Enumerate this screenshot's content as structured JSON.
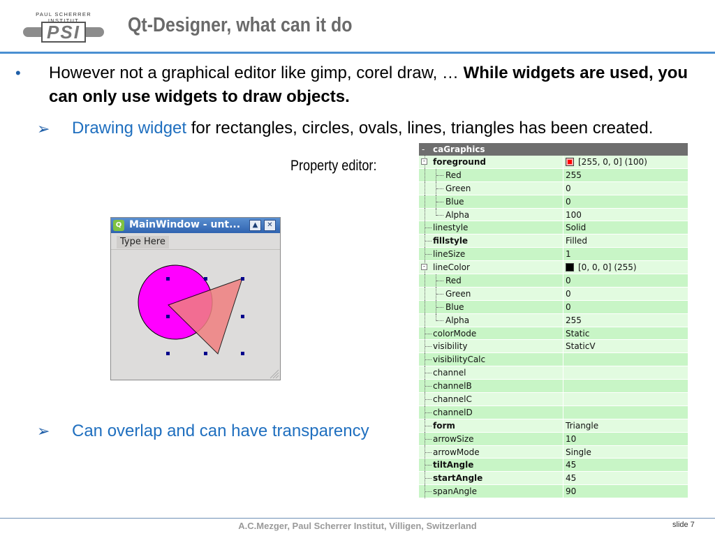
{
  "header": {
    "logo_caption": "PAUL SCHERRER INSTITUT",
    "logo_mark": "PSI",
    "title": "Qt-Designer, what can it do"
  },
  "bullets": {
    "b1_normal": "However not a graphical editor like gimp, corel draw, … ",
    "b1_bold": "While widgets are used, you can only use widgets to draw objects.",
    "sub1_highlight": "Drawing widget",
    "sub1_rest": " for rectangles, circles, ovals, lines, triangles has been created.",
    "property_label": "Property editor:",
    "sub2": "Can overlap and can have transparency"
  },
  "main_window": {
    "title": "MainWindow - unt...",
    "menu_placeholder": "Type Here",
    "colors": {
      "circle": "#ff00ff",
      "triangle": "#f08080",
      "handle": "#00008b"
    }
  },
  "property_editor": {
    "header": "caGraphics",
    "collapse_glyph": "-",
    "rows": [
      {
        "name": "foreground",
        "value": "[255, 0, 0] (100)",
        "bold": true,
        "level": 0,
        "expander": true,
        "swatch": "red"
      },
      {
        "name": "Red",
        "value": "255",
        "level": 1,
        "last": false
      },
      {
        "name": "Green",
        "value": "0",
        "level": 1,
        "last": false
      },
      {
        "name": "Blue",
        "value": "0",
        "level": 1,
        "last": false
      },
      {
        "name": "Alpha",
        "value": "100",
        "level": 1,
        "last": true
      },
      {
        "name": "linestyle",
        "value": "Solid",
        "level": 0
      },
      {
        "name": "fillstyle",
        "value": "Filled",
        "bold": true,
        "level": 0
      },
      {
        "name": "lineSize",
        "value": "1",
        "level": 0
      },
      {
        "name": "lineColor",
        "value": "[0, 0, 0] (255)",
        "level": 0,
        "expander": true,
        "swatch": "black"
      },
      {
        "name": "Red",
        "value": "0",
        "level": 1,
        "last": false
      },
      {
        "name": "Green",
        "value": "0",
        "level": 1,
        "last": false
      },
      {
        "name": "Blue",
        "value": "0",
        "level": 1,
        "last": false
      },
      {
        "name": "Alpha",
        "value": "255",
        "level": 1,
        "last": true
      },
      {
        "name": "colorMode",
        "value": "Static",
        "level": 0
      },
      {
        "name": "visibility",
        "value": "StaticV",
        "level": 0
      },
      {
        "name": "visibilityCalc",
        "value": "",
        "level": 0
      },
      {
        "name": "channel",
        "value": "",
        "level": 0
      },
      {
        "name": "channelB",
        "value": "",
        "level": 0
      },
      {
        "name": "channelC",
        "value": "",
        "level": 0
      },
      {
        "name": "channelD",
        "value": "",
        "level": 0
      },
      {
        "name": "form",
        "value": "Triangle",
        "bold": true,
        "level": 0
      },
      {
        "name": "arrowSize",
        "value": "10",
        "level": 0
      },
      {
        "name": "arrowMode",
        "value": "Single",
        "level": 0
      },
      {
        "name": "tiltAngle",
        "value": "45",
        "bold": true,
        "level": 0
      },
      {
        "name": "startAngle",
        "value": "45",
        "bold": true,
        "level": 0
      },
      {
        "name": "spanAngle",
        "value": "90",
        "level": 0
      }
    ]
  },
  "footer": {
    "text": "A.C.Mezger, Paul Scherrer Institut, Villigen, Switzerland",
    "slide": "slide 7"
  }
}
